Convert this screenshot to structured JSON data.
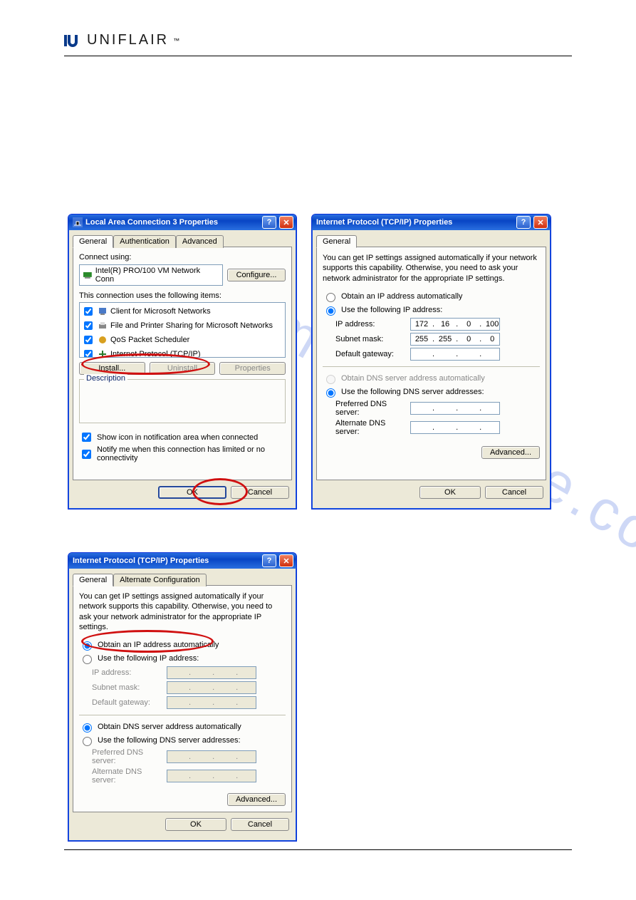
{
  "brand": {
    "name": "UNIFLAIR"
  },
  "dialog_lan": {
    "title": "Local Area Connection 3 Properties",
    "tabs": {
      "general": "General",
      "auth": "Authentication",
      "advanced": "Advanced"
    },
    "connect_using_label": "Connect using:",
    "connect_using_value": "Intel(R) PRO/100 VM Network Conn",
    "configure_btn": "Configure...",
    "items_label": "This connection uses the following items:",
    "items": [
      {
        "label": "Client for Microsoft Networks",
        "checked": true
      },
      {
        "label": "File and Printer Sharing for Microsoft Networks",
        "checked": true
      },
      {
        "label": "QoS Packet Scheduler",
        "checked": true
      },
      {
        "label": "Internet Protocol (TCP/IP)",
        "checked": true
      }
    ],
    "install_btn": "Install...",
    "uninstall_btn": "Uninstall",
    "properties_btn": "Properties",
    "description_label": "Description",
    "show_icon": "Show icon in notification area when connected",
    "notify_limited": "Notify me when this connection has limited or no connectivity",
    "ok_btn": "OK",
    "cancel_btn": "Cancel"
  },
  "dialog_ip1": {
    "title": "Internet Protocol (TCP/IP) Properties",
    "tabs": {
      "general": "General"
    },
    "intro": "You can get IP settings assigned automatically if your network supports this capability. Otherwise, you need to ask your network administrator for the appropriate IP settings.",
    "radio_auto": "Obtain an IP address automatically",
    "radio_manual": "Use the following IP address:",
    "ip_label": "IP address:",
    "ip_value": [
      "172",
      "16",
      "0",
      "100"
    ],
    "mask_label": "Subnet mask:",
    "mask_value": [
      "255",
      "255",
      "0",
      "0"
    ],
    "gw_label": "Default gateway:",
    "gw_value": [
      "",
      "",
      "",
      ""
    ],
    "radio_dns_auto": "Obtain DNS server address automatically",
    "radio_dns_manual": "Use the following DNS server addresses:",
    "pref_dns_label": "Preferred DNS server:",
    "alt_dns_label": "Alternate DNS server:",
    "advanced_btn": "Advanced...",
    "ok_btn": "OK",
    "cancel_btn": "Cancel"
  },
  "dialog_ip2": {
    "title": "Internet Protocol (TCP/IP) Properties",
    "tabs": {
      "general": "General",
      "alt": "Alternate Configuration"
    },
    "intro": "You can get IP settings assigned automatically if your network supports this capability. Otherwise, you need to ask your network administrator for the appropriate IP settings.",
    "radio_auto": "Obtain an IP address automatically",
    "radio_manual": "Use the following IP address:",
    "ip_label": "IP address:",
    "mask_label": "Subnet mask:",
    "gw_label": "Default gateway:",
    "radio_dns_auto": "Obtain DNS server address automatically",
    "radio_dns_manual": "Use the following DNS server addresses:",
    "pref_dns_label": "Preferred DNS server:",
    "alt_dns_label": "Alternate DNS server:",
    "advanced_btn": "Advanced...",
    "ok_btn": "OK",
    "cancel_btn": "Cancel"
  }
}
